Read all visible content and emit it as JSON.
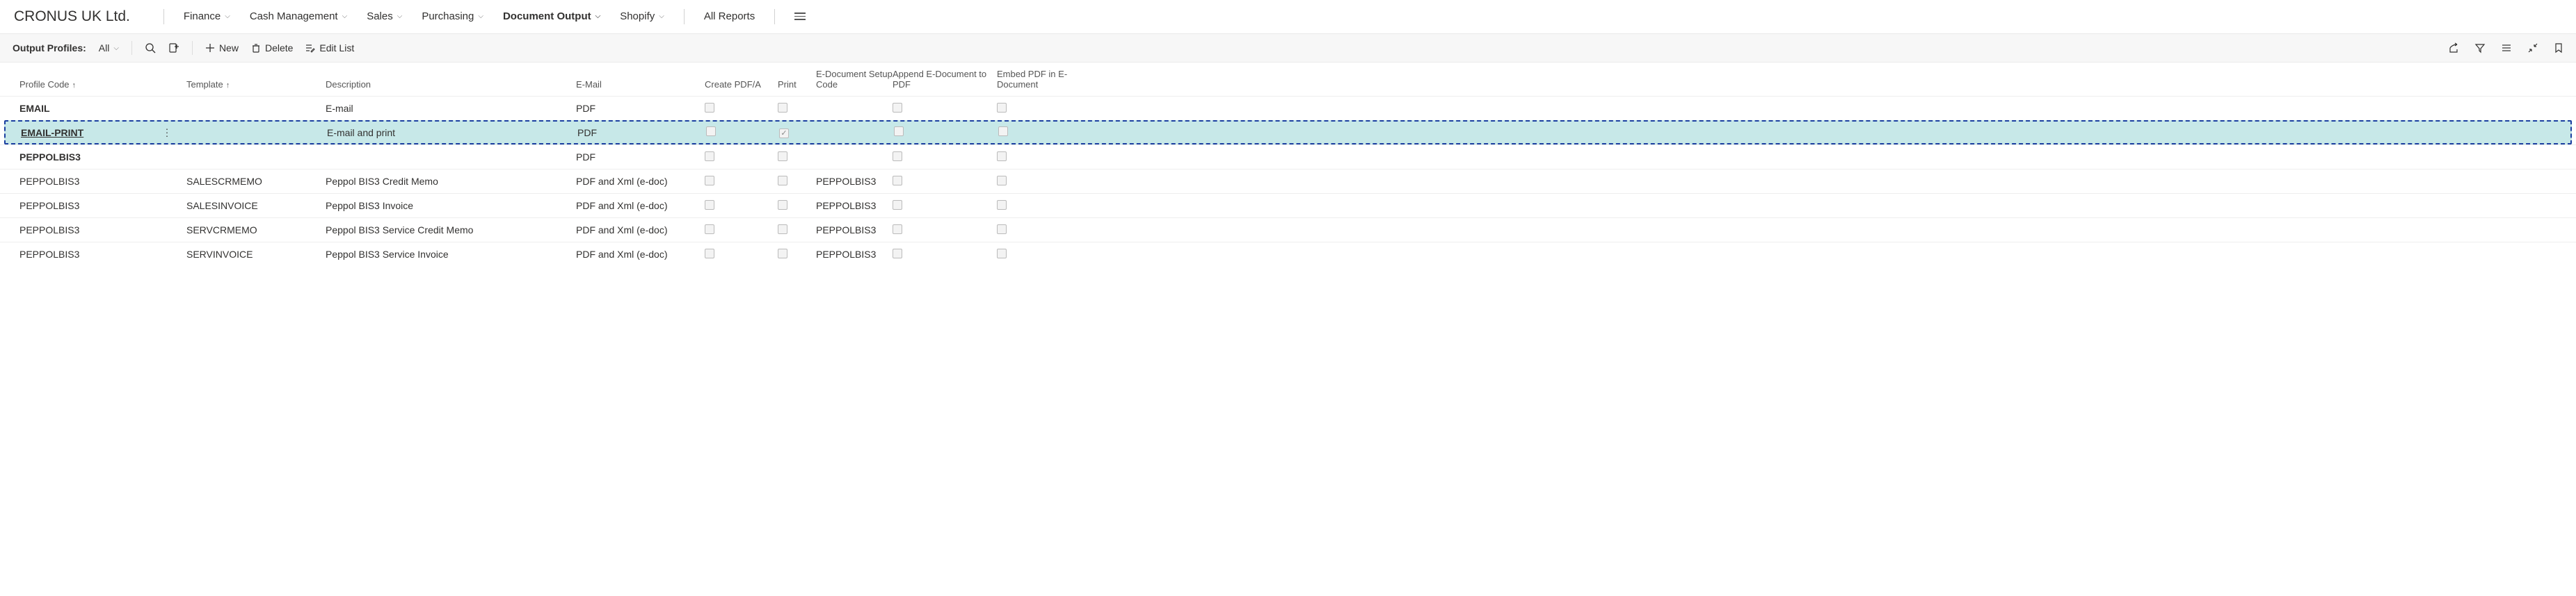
{
  "header": {
    "company": "CRONUS UK Ltd.",
    "nav": [
      {
        "label": "Finance",
        "active": false
      },
      {
        "label": "Cash Management",
        "active": false
      },
      {
        "label": "Sales",
        "active": false
      },
      {
        "label": "Purchasing",
        "active": false
      },
      {
        "label": "Document Output",
        "active": true
      },
      {
        "label": "Shopify",
        "active": false
      }
    ],
    "all_reports": "All Reports"
  },
  "actionbar": {
    "title": "Output Profiles:",
    "filter_label": "All",
    "new_label": "New",
    "delete_label": "Delete",
    "edit_list_label": "Edit List"
  },
  "grid": {
    "columns": {
      "profile_code": "Profile Code",
      "template": "Template",
      "description": "Description",
      "email": "E-Mail",
      "create_pdfa": "Create PDF/A",
      "print": "Print",
      "edoc_setup": "E-Document Setup Code",
      "append_edoc": "Append E-Document to PDF",
      "embed_pdf": "Embed PDF in E-Document"
    },
    "rows": [
      {
        "code": "EMAIL",
        "template": "",
        "description": "E-mail",
        "email": "PDF",
        "create_pdfa": false,
        "print": false,
        "edoc": "",
        "append": false,
        "embed": false,
        "bold": true,
        "selected": false
      },
      {
        "code": "EMAIL-PRINT",
        "template": "",
        "description": "E-mail and print",
        "email": "PDF",
        "create_pdfa": false,
        "print": true,
        "edoc": "",
        "append": false,
        "embed": false,
        "bold": true,
        "selected": true
      },
      {
        "code": "PEPPOLBIS3",
        "template": "",
        "description": "",
        "email": "PDF",
        "create_pdfa": false,
        "print": false,
        "edoc": "",
        "append": false,
        "embed": false,
        "bold": true,
        "selected": false
      },
      {
        "code": "PEPPOLBIS3",
        "template": "SALESCRMEMO",
        "description": "Peppol BIS3 Credit Memo",
        "email": "PDF and Xml (e-doc)",
        "create_pdfa": false,
        "print": false,
        "edoc": "PEPPOLBIS3",
        "append": false,
        "embed": false,
        "bold": false,
        "selected": false
      },
      {
        "code": "PEPPOLBIS3",
        "template": "SALESINVOICE",
        "description": "Peppol BIS3 Invoice",
        "email": "PDF and Xml (e-doc)",
        "create_pdfa": false,
        "print": false,
        "edoc": "PEPPOLBIS3",
        "append": false,
        "embed": false,
        "bold": false,
        "selected": false
      },
      {
        "code": "PEPPOLBIS3",
        "template": "SERVCRMEMO",
        "description": "Peppol BIS3 Service Credit Memo",
        "email": "PDF and Xml (e-doc)",
        "create_pdfa": false,
        "print": false,
        "edoc": "PEPPOLBIS3",
        "append": false,
        "embed": false,
        "bold": false,
        "selected": false
      },
      {
        "code": "PEPPOLBIS3",
        "template": "SERVINVOICE",
        "description": "Peppol BIS3 Service Invoice",
        "email": "PDF and Xml (e-doc)",
        "create_pdfa": false,
        "print": false,
        "edoc": "PEPPOLBIS3",
        "append": false,
        "embed": false,
        "bold": false,
        "selected": false
      }
    ]
  }
}
